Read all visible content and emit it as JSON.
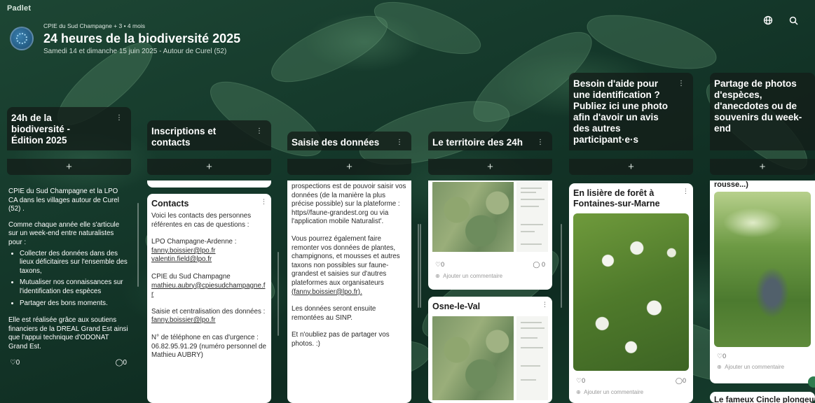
{
  "app": {
    "brand": "Padlet"
  },
  "header": {
    "meta": "CPIE du Sud Champagne + 3 • 4 mois",
    "title": "24 heures de la biodiversité 2025",
    "subtitle": "Samedi 14 et dimanche 15 juin 2025 - Autour de Curel (52)"
  },
  "top_icons": [
    "globe-icon",
    "search-icon"
  ],
  "columns": [
    {
      "title": "24h de la biodiversité - Édition 2025"
    },
    {
      "title": "Inscriptions et contacts"
    },
    {
      "title": "Saisie des données"
    },
    {
      "title": "Le territoire des 24h"
    },
    {
      "title": "Besoin d'aide pour une identification ? Publiez ici une photo afin d'avoir un avis des autres participant·e·s"
    },
    {
      "title": "Partage de photos d'espèces, d'anecdotes ou de souvenirs du week-end"
    }
  ],
  "col1": {
    "p1": "CPIE du Sud Champagne et la LPO CA dans les villages autour de Curel (52) .",
    "p2": "Comme chaque année elle s'articule sur un week-end entre naturalistes pour :",
    "bullets": [
      "Collecter des données dans des lieux déficitaires sur l'ensemble des taxons,",
      "Mutualiser nos connaissances sur l'identification des espèces",
      "Partager des bons moments."
    ],
    "p3": "Elle est réalisée grâce aux soutiens financiers de la DREAL Grand Est ainsi que l'appui technique d'ODONAT Grand Est.",
    "likes": "0",
    "comments": "0"
  },
  "col2": {
    "card_title": "Contacts",
    "intro": "Voici les contacts des personnes référentes en cas de questions :",
    "lpo_label": "LPO Champagne-Ardenne :",
    "lpo_email1": "fanny.boissier@lpo.fr",
    "lpo_email2": "valentin.field@lpo.fr",
    "cpie_label": "CPIE du Sud Champagne",
    "cpie_email": "mathieu.aubry@cpiesudchampagne.fr",
    "saisie_label": "Saisie et centralisation des données :",
    "saisie_email": "fanny.boissier@lpo.fr",
    "phone": "N° de téléphone en cas d'urgence : 06.82.95.91.29 (numéro personnel de Mathieu AUBRY)"
  },
  "col3": {
    "p1": "prospections est de pouvoir saisir vos données (de la manière la plus précise possible) sur la plateforme : https//faune-grandest.org ou via l'application mobile Naturalist'.",
    "p2_a": "Vous pourrez également faire remonter vos données de plantes, champignons, et mousses et autres taxons non possibles sur faune-grandest et saisies sur d'autres plateformes aux organisateurs",
    "p2_link": "(fanny.boissier@lpo.fr).",
    "p3": "Les données seront ensuite remontées au SINP.",
    "p4": "Et n'oubliez pas de partager vos photos. :)"
  },
  "col4": {
    "likes": "0",
    "comments": "0",
    "add_comment": "Ajouter un commentaire",
    "card2_title": "Osne-le-Val"
  },
  "col5": {
    "card_title": "En lisière de forêt à Fontaines-sur-Marne",
    "likes": "0",
    "comments": "0",
    "add_comment": "Ajouter un commentaire"
  },
  "col6": {
    "top_text": "rousse...)",
    "likes": "0",
    "add_comment": "Ajouter un commentaire",
    "card2_title": "Le fameux Cincle plongeur"
  },
  "colors": {
    "accent": "#2f7d4f",
    "card": "#ffffff",
    "header_bg": "#14201a"
  }
}
